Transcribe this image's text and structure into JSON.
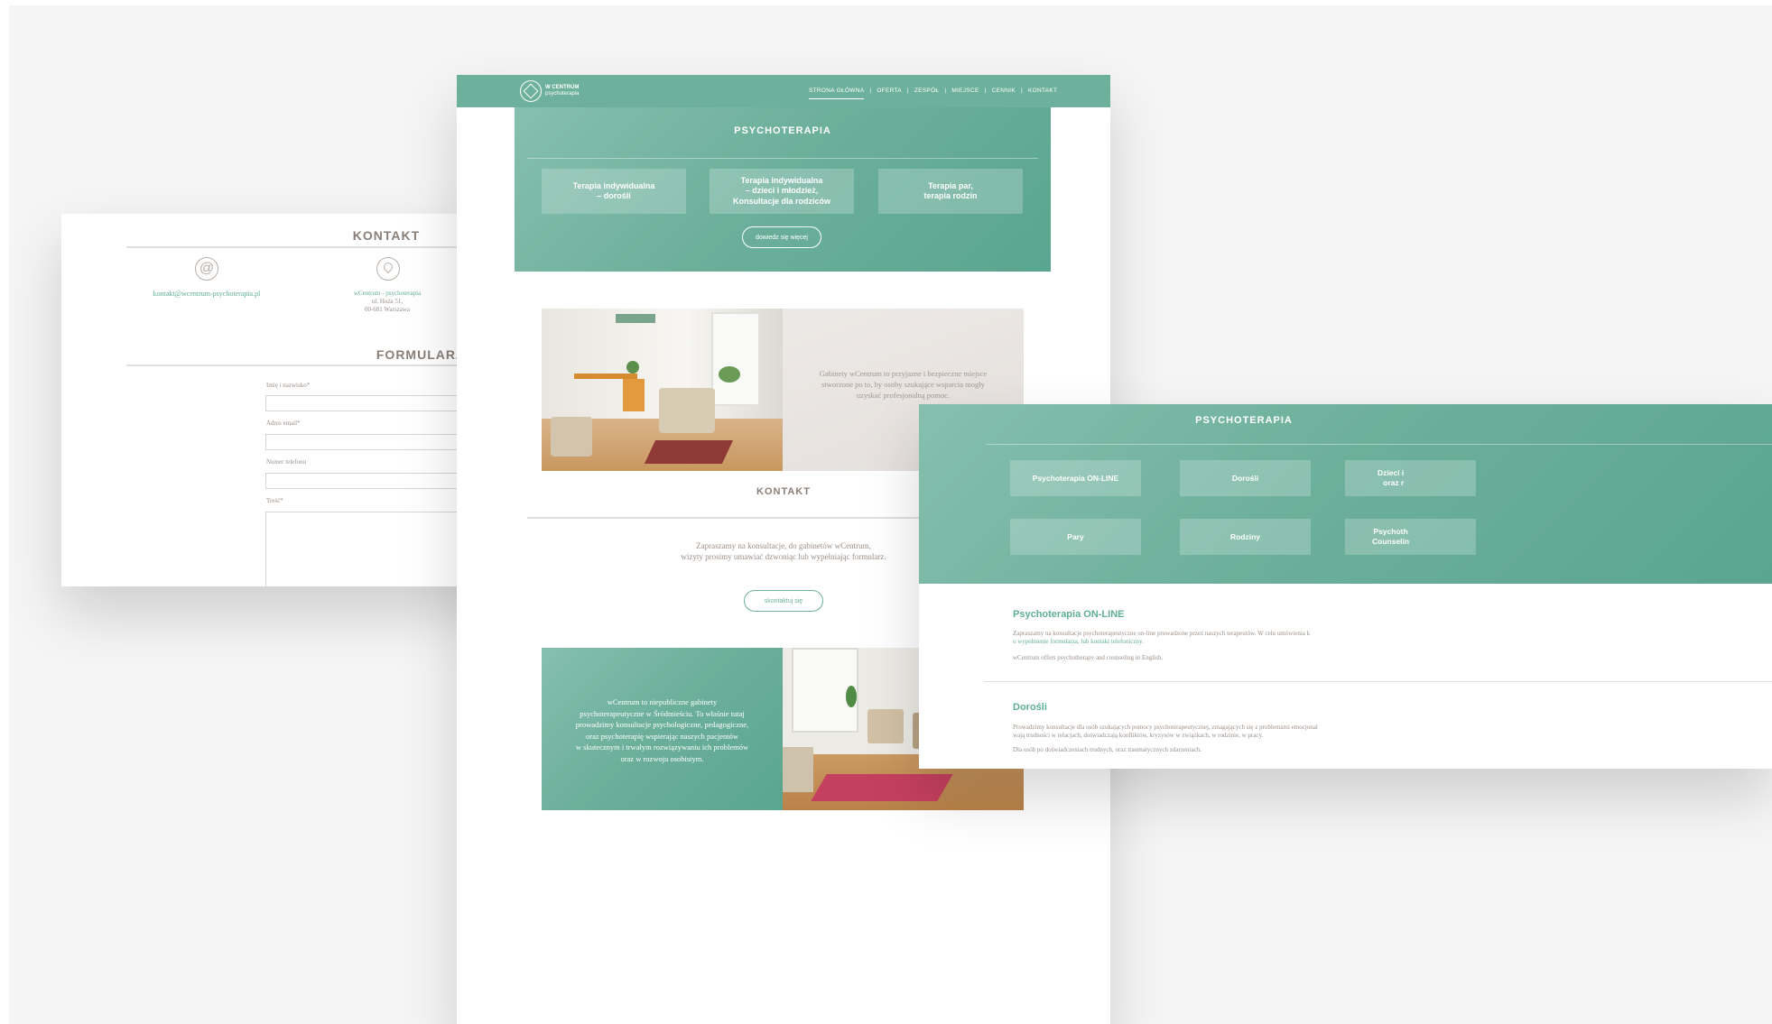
{
  "contact_card": {
    "title": "KONTAKT",
    "email": "kontakt@wcentrum-psychoterapia.pl",
    "address": {
      "line1": "wCentrum - psychoterapia",
      "line2": "ul. Hoża 51,",
      "line3": "00-681 Warszawa"
    },
    "form_title": "FORMULARZ KONTAKTOWY",
    "fields": {
      "name": "Imię i nazwisko*",
      "email": "Adres email*",
      "phone": "Numer telefonu",
      "message": "Treść*"
    }
  },
  "main_page": {
    "logo": {
      "line1": "W CENTRUM",
      "line2": "psychoterapia"
    },
    "nav": [
      "STRONA GŁÓWNA",
      "OFERTA",
      "ZESPÓŁ",
      "MIEJSCE",
      "CENNIK",
      "KONTAKT"
    ],
    "hero": {
      "title": "PSYCHOTERAPIA",
      "tiles": [
        {
          "l1": "Terapia indywidualna",
          "l2": "– dorośli",
          "l3": ""
        },
        {
          "l1": "Terapia indywidualna",
          "l2": "– dzieci i młodzież,",
          "l3": "Konsultacje dla rodziców"
        },
        {
          "l1": "Terapia par,",
          "l2": "terapia rodzin",
          "l3": ""
        }
      ],
      "more_button": "dowiedz się więcej"
    },
    "place_text": {
      "l1": "Gabinety wCentrum to przyjazne i bezpieczne miejsce",
      "l2": "stworzone po to, by osoby szukające wsparcia mogły",
      "l3": "uzyskać profesjonalną pomoc."
    },
    "kontakt": {
      "title": "KONTAKT",
      "l1": "Zapraszamy na konsultacje, do gabinetów wCentrum,",
      "l2": "wizyty prosimy umawiać dzwoniąc lub wypełniając formularz.",
      "button": "skontaktuj się"
    },
    "about": {
      "l1": "wCentrum to niepubliczne gabinety",
      "l2": "psychoterapeutyczne w Śródmieściu. To właśnie tutaj",
      "l3": "prowadzimy konsultacje psychologiczne, pedagogiczne,",
      "l4": "oraz psychoterapię wspierając naszych pacjentów",
      "l5": "w skutecznym i trwałym rozwiązywaniu ich problemów",
      "l6": "oraz w rozwoju osobistym."
    }
  },
  "offer_card": {
    "title": "PSYCHOTERAPIA",
    "tiles": [
      {
        "l1": "Psychoterapia ON-LINE",
        "l2": ""
      },
      {
        "l1": "Dorośli",
        "l2": ""
      },
      {
        "l1": "Dzieci i",
        "l2": "oraz r"
      },
      {
        "l1": "Pary",
        "l2": ""
      },
      {
        "l1": "Rodziny",
        "l2": ""
      },
      {
        "l1": "Psychoth",
        "l2": "Counselin"
      }
    ],
    "online": {
      "title": "Psychoterapia ON-LINE",
      "p1a": "Zapraszamy na konsultacje psychoterapeutyczne on-line prowadzone przez naszych terapeutów. W celu umówienia k",
      "p1b": "o wypełnienie formularza, lub kontakt telefoniczny.",
      "p2": "wCentrum offers psychotherapy and counseling in English."
    },
    "adults": {
      "title": "Dorośli",
      "p1a": "Prowadzimy konsultacje dla osób szukających pomocy psychoterapeutycznej, zmagających się z problemami emocjonal",
      "p1b": "wają trudności w relacjach, doświadczają konfliktów, kryzysów w związkach, w rodzinie, w pracy.",
      "p2": "Dla osób po doświadczeniach trudnych, oraz traumatycznych zdarzeniach."
    }
  },
  "colors": {
    "accent": "#6db09b",
    "text": "#8a7f78",
    "link": "#5fae96"
  }
}
